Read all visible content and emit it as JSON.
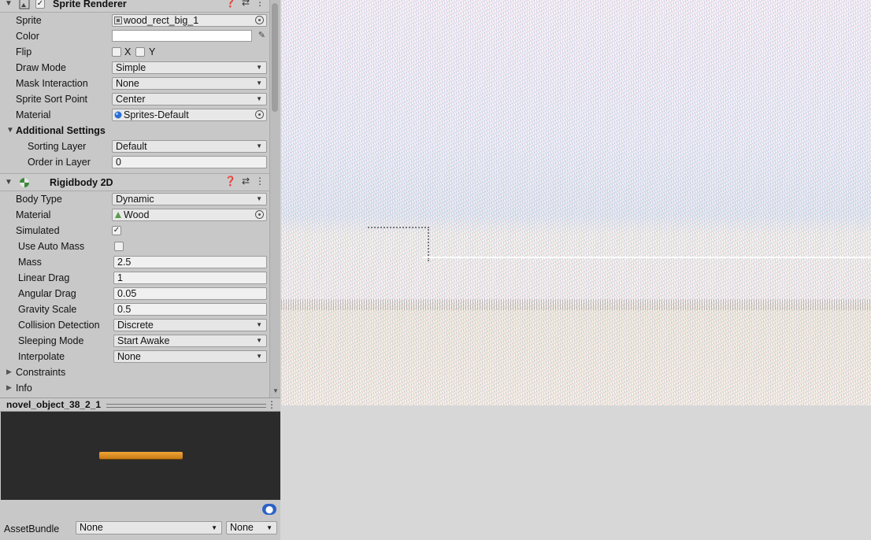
{
  "sprite_renderer": {
    "title": "Sprite Renderer",
    "fields": {
      "sprite_label": "Sprite",
      "sprite_value": "wood_rect_big_1",
      "color_label": "Color",
      "flip_label": "Flip",
      "flip_x": "X",
      "flip_y": "Y",
      "draw_mode_label": "Draw Mode",
      "draw_mode_value": "Simple",
      "mask_label": "Mask Interaction",
      "mask_value": "None",
      "sort_point_label": "Sprite Sort Point",
      "sort_point_value": "Center",
      "material_label": "Material",
      "material_value": "Sprites-Default"
    },
    "additional": {
      "title": "Additional Settings",
      "sorting_layer_label": "Sorting Layer",
      "sorting_layer_value": "Default",
      "order_label": "Order in Layer",
      "order_value": "0"
    }
  },
  "rigidbody": {
    "title": "Rigidbody 2D",
    "body_type_label": "Body Type",
    "body_type_value": "Dynamic",
    "material_label": "Material",
    "material_value": "Wood",
    "simulated_label": "Simulated",
    "simulated_check": "✓",
    "auto_mass_label": "Use Auto Mass",
    "mass_label": "Mass",
    "mass_value": "2.5",
    "linear_drag_label": "Linear Drag",
    "linear_drag_value": "1",
    "angular_drag_label": "Angular Drag",
    "angular_drag_value": "0.05",
    "gravity_label": "Gravity Scale",
    "gravity_value": "0.5",
    "collision_label": "Collision Detection",
    "collision_value": "Discrete",
    "sleeping_label": "Sleeping Mode",
    "sleeping_value": "Start Awake",
    "interpolate_label": "Interpolate",
    "interpolate_value": "None",
    "constraints_label": "Constraints",
    "info_label": "Info"
  },
  "preview": {
    "name": "novel_object_38_2_1"
  },
  "asset_bundle": {
    "label": "AssetBundle",
    "name_value": "None",
    "variant_value": "None"
  },
  "icons": [
    "fold-arrow-icon",
    "sprite-renderer-icon",
    "help-icon",
    "preset-icon",
    "kebab-menu-icon",
    "object-picker-icon",
    "eyedropper-icon",
    "material-sphere-icon",
    "physics-material-icon",
    "rigidbody-icon",
    "tag-icon"
  ]
}
